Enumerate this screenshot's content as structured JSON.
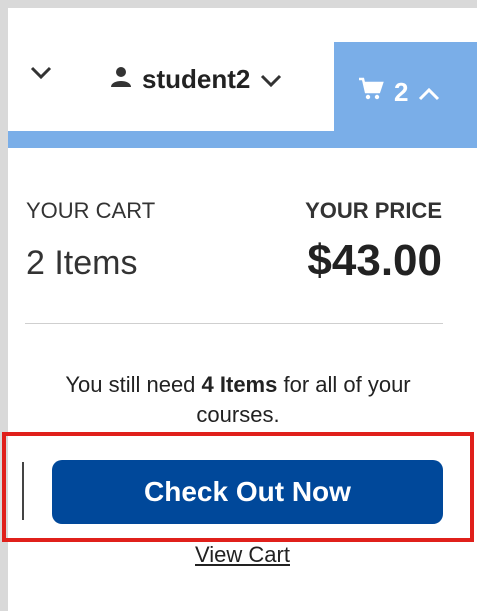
{
  "nav": {
    "user_name": "student2",
    "cart_count": "2"
  },
  "cart": {
    "your_cart_label": "YOUR CART",
    "your_price_label": "YOUR PRICE",
    "items_count": "2 Items",
    "price": "$43.00",
    "need_prefix": "You still need ",
    "need_count": "4 Items",
    "need_suffix": " for all of your courses.",
    "checkout_label": "Check Out Now",
    "view_cart_label": "View Cart"
  },
  "colors": {
    "accent_blue": "#7aaee8",
    "button_blue": "#00489a",
    "highlight_red": "#e0201b"
  }
}
